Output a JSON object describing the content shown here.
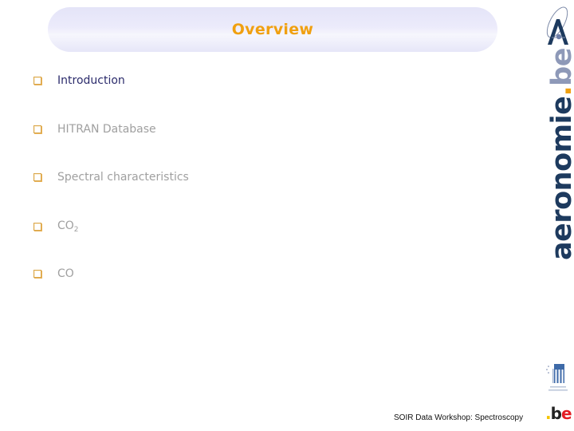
{
  "slide": {
    "title": "Overview",
    "agenda": [
      {
        "label": "Introduction",
        "state": "current"
      },
      {
        "label": "HITRAN Database",
        "state": "upcoming"
      },
      {
        "label": "Spectral characteristics",
        "state": "upcoming"
      },
      {
        "label": "CO",
        "subscript": "2",
        "state": "upcoming"
      },
      {
        "label": "CO",
        "state": "upcoming"
      }
    ],
    "bullet_icon": "square-bullet-icon"
  },
  "branding": {
    "vertical_main": "aeronomie",
    "vertical_dot": ".",
    "vertical_tld": "be",
    "be_logo_dot": ".",
    "be_logo_b": "b",
    "be_logo_e": "e",
    "logo_icon": "aeronomie-a-logo-icon",
    "belspo_icon": "belspo-logo-icon"
  },
  "footer": {
    "text": "SOIR Data Workshop: Spectroscopy"
  },
  "colors": {
    "title": "#f0a010",
    "active_item": "#2c2c6c",
    "inactive_item": "#a0a0a0",
    "brand_navy": "#1d3a5e",
    "brand_orange": "#f0a010",
    "brand_grey": "#8e99b8"
  }
}
